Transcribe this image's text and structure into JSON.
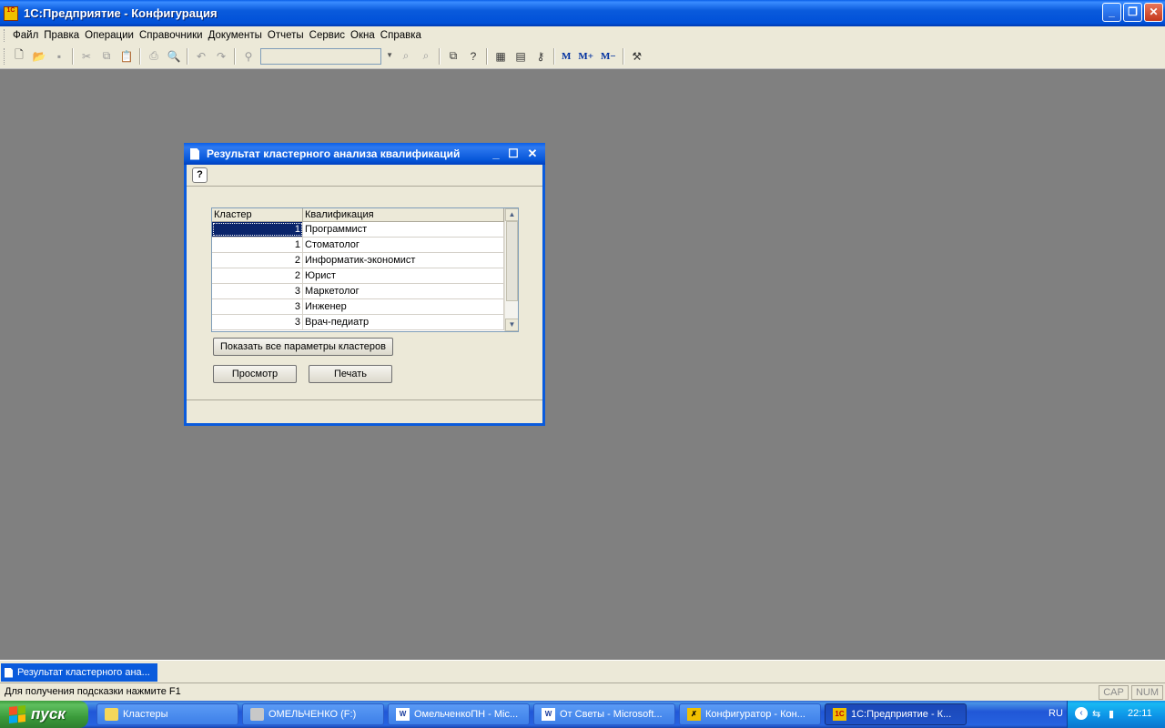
{
  "app": {
    "title": "1С:Предприятие - Конфигурация",
    "icon_text": "1C"
  },
  "window_buttons": {
    "minimize": "_",
    "restore": "❐",
    "close": "✕"
  },
  "menu": [
    "Файл",
    "Правка",
    "Операции",
    "Справочники",
    "Документы",
    "Отчеты",
    "Сервис",
    "Окна",
    "Справка"
  ],
  "toolbar": {
    "search_value": "",
    "m_label": "M",
    "m_plus_label": "M+",
    "m_minus_label": "M−"
  },
  "dialog": {
    "title": "Результат кластерного анализа квалификаций",
    "help_label": "?",
    "grid": {
      "columns": [
        "Кластер",
        "Квалификация"
      ],
      "rows": [
        {
          "cluster": "1",
          "qualification": "Программист"
        },
        {
          "cluster": "1",
          "qualification": "Стоматолог"
        },
        {
          "cluster": "2",
          "qualification": "Информатик-экономист"
        },
        {
          "cluster": "2",
          "qualification": "Юрист"
        },
        {
          "cluster": "3",
          "qualification": "Маркетолог"
        },
        {
          "cluster": "3",
          "qualification": "Инженер"
        },
        {
          "cluster": "3",
          "qualification": "Врач-педиатр"
        }
      ]
    },
    "show_params_label": "Показать все параметры кластеров",
    "preview_label": "Просмотр",
    "print_label": "Печать"
  },
  "window_list": {
    "active_tab": "Результат кластерного ана..."
  },
  "statusbar": {
    "hint": "Для получения подсказки нажмите F1",
    "cap": "CAP",
    "num": "NUM"
  },
  "taskbar": {
    "start_label": "пуск",
    "tasks": [
      {
        "label": "Кластеры",
        "icon": "folder-icon"
      },
      {
        "label": "ОМЕЛЬЧЕНКО (F:)",
        "icon": "drive-icon"
      },
      {
        "label": "ОмельченкоПН - Mic...",
        "icon": "word-icon"
      },
      {
        "label": "От Светы - Microsoft...",
        "icon": "word-icon"
      },
      {
        "label": "Конфигуратор - Кон...",
        "icon": "configurator-icon"
      },
      {
        "label": "1С:Предприятие - К...",
        "icon": "1c-icon"
      }
    ],
    "lang": "RU",
    "clock": "22:11"
  }
}
